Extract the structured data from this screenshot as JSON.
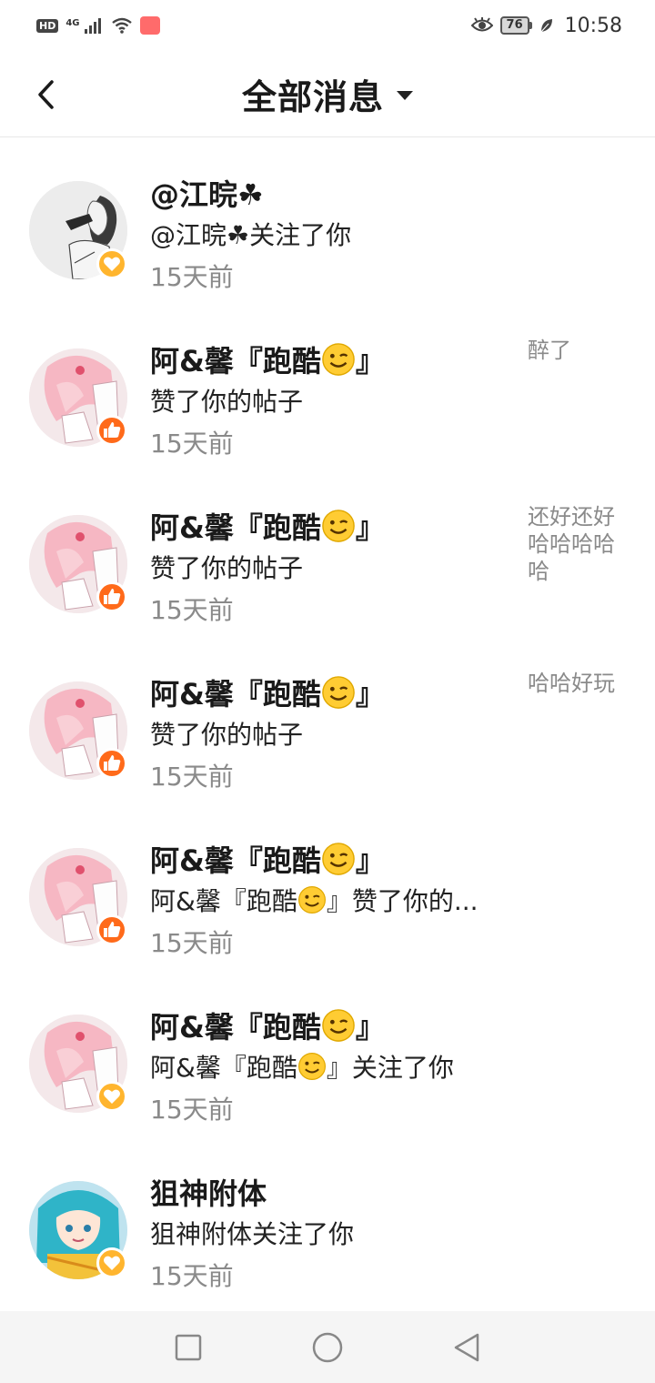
{
  "status_bar": {
    "hd": "HD",
    "network": "4G",
    "battery": "76",
    "time": "10:58"
  },
  "header": {
    "title": "全部消息"
  },
  "messages": [
    {
      "name": "@江晥☘",
      "desc": "@江晥☘关注了你",
      "time": "15天前",
      "badge": "heart",
      "preview": ""
    },
    {
      "name_prefix": "阿&馨『跑酷",
      "name_suffix": "』",
      "desc": "赞了你的帖子",
      "time": "15天前",
      "badge": "like",
      "preview": "醉了"
    },
    {
      "name_prefix": "阿&馨『跑酷",
      "name_suffix": "』",
      "desc": "赞了你的帖子",
      "time": "15天前",
      "badge": "like",
      "preview": "还好还好哈哈哈哈哈"
    },
    {
      "name_prefix": "阿&馨『跑酷",
      "name_suffix": "』",
      "desc": "赞了你的帖子",
      "time": "15天前",
      "badge": "like",
      "preview": "哈哈好玩"
    },
    {
      "name_prefix": "阿&馨『跑酷",
      "name_suffix": "』",
      "desc_prefix": "阿&馨『跑酷",
      "desc_suffix": "』赞了你的...",
      "time": "15天前",
      "badge": "like",
      "preview": ""
    },
    {
      "name_prefix": "阿&馨『跑酷",
      "name_suffix": "』",
      "desc_prefix": "阿&馨『跑酷",
      "desc_suffix": "』关注了你",
      "time": "15天前",
      "badge": "heart",
      "preview": ""
    },
    {
      "name": "狙神附体",
      "desc": "狙神附体关注了你",
      "time": "15天前",
      "badge": "heart",
      "preview": ""
    }
  ],
  "colors": {
    "heart_badge": "#ffb52e",
    "like_badge": "#ff6a1a",
    "secondary_text": "#8a8a8a"
  },
  "icons": {
    "back": "chevron-left-icon",
    "dropdown": "caret-down-icon",
    "heart": "heart-icon",
    "like": "thumbs-up-icon",
    "emoji": "winking-face-emoji"
  }
}
